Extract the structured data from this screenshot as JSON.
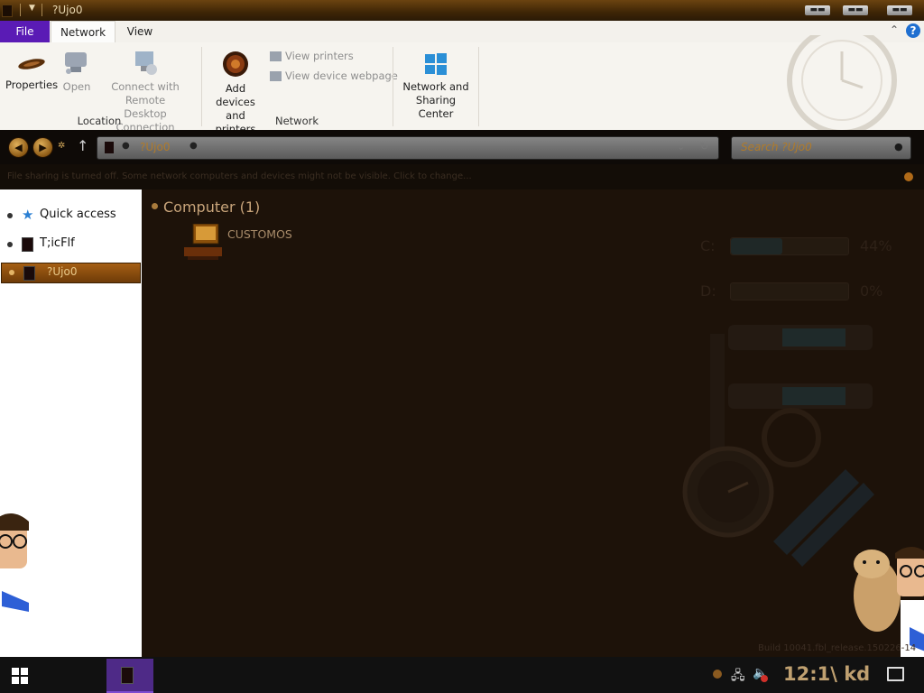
{
  "window": {
    "title": "?Ujo0",
    "minimize_label": "▬▬",
    "maximize_label": "▬▬",
    "close_label": "▬▬"
  },
  "ribbon": {
    "tabs": {
      "file": "File",
      "network": "Network",
      "view": "View"
    },
    "help_label": "?",
    "location_group": {
      "label": "Location",
      "properties": "Properties",
      "open": "Open",
      "connect_remote_line1": "Connect with Remote",
      "connect_remote_line2": "Desktop Connection"
    },
    "network_group": {
      "label": "Network",
      "add_devices_line1": "Add devices",
      "add_devices_line2": "and printers",
      "view_printers": "View printers",
      "view_device_webpage": "View device webpage"
    },
    "sharing_center_line1": "Network and",
    "sharing_center_line2": "Sharing Center"
  },
  "address": {
    "path": "?Ujo0",
    "search_placeholder": "Search ?Ujo0"
  },
  "infobar": {
    "message": "File sharing is turned off. Some network computers and devices might not be visible. Click to change..."
  },
  "navpane": {
    "items": [
      {
        "label": "Quick access",
        "icon": "star-icon"
      },
      {
        "label": "T;icFlf",
        "icon": "folder-icon"
      },
      {
        "label": "?Ujo0",
        "icon": "network-icon",
        "selected": true
      }
    ]
  },
  "content": {
    "group_title": "Computer (1)",
    "items": [
      {
        "label": "CUSTOMOS",
        "icon": "computer-icon"
      }
    ]
  },
  "gadget": {
    "drives": [
      {
        "letter": "C:",
        "percent_label": "44%",
        "used_fraction": 0.44
      },
      {
        "letter": "D:",
        "percent_label": "0%",
        "used_fraction": 0.0
      }
    ],
    "build_text": "Build 10041.fbl_release.150226-14"
  },
  "taskbar": {
    "clock": "12:1\\ kd"
  },
  "colors": {
    "file_tab": "#5a1bb5",
    "selection": "#8a4a0e",
    "background": "#1d1209",
    "accent_text": "#c8a47a"
  }
}
